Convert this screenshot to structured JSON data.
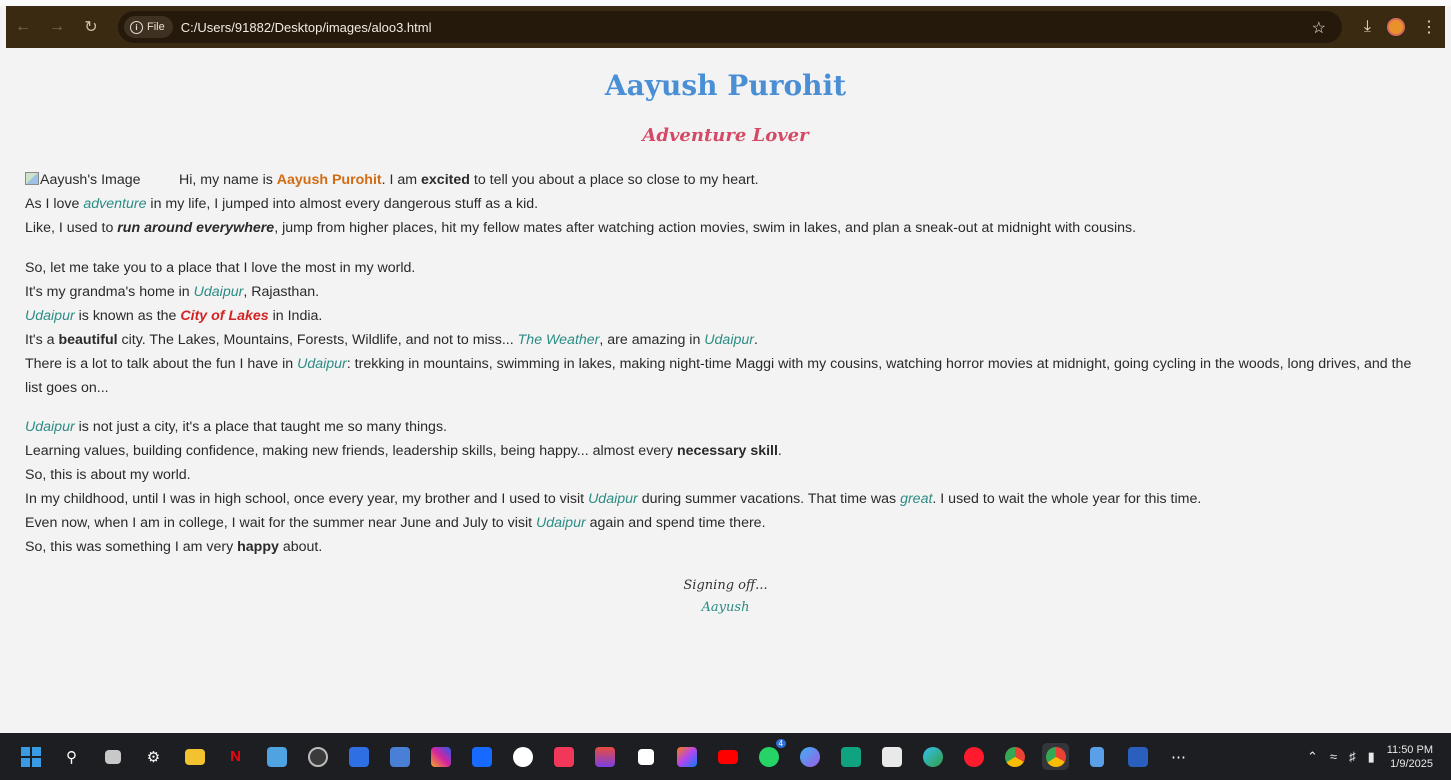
{
  "browser": {
    "site_chip": "File",
    "url": "C:/Users/91882/Desktop/images/aloo3.html"
  },
  "page": {
    "title": "Aayush Purohit",
    "subtitle": "Adventure Lover",
    "image_alt": "Aayush's Image",
    "p1": {
      "l1a": "Hi, my name is ",
      "name": "Aayush Purohit",
      "l1b": ". I am ",
      "excited": "excited",
      "l1c": " to tell you about a place so close to my heart.",
      "l2a": "As I love ",
      "adventure": "adventure",
      "l2b": " in my life, I jumped into almost every dangerous stuff as a kid.",
      "l3a": "Like, I used to ",
      "run": "run around everywhere",
      "l3b": ", jump from higher places, hit my fellow mates after watching action movies, swim in lakes, and plan a sneak-out at midnight with cousins."
    },
    "p2": {
      "l1": "So, let me take you to a place that I love the most in my world.",
      "l2a": "It's my grandma's home in ",
      "udaipur": "Udaipur",
      "l2b": ", Rajasthan.",
      "l3a": " is known as the ",
      "city_of_lakes": "City of Lakes",
      "l3b": " in India.",
      "l4a": "It's a ",
      "beautiful": "beautiful",
      "l4b": " city. The Lakes, Mountains, Forests, Wildlife, and not to miss... ",
      "weather": "The Weather",
      "l4c": ", are amazing in ",
      "l4d": ".",
      "l5a": "There is a lot to talk about the fun I have in ",
      "l5b": ": trekking in mountains, swimming in lakes, making night-time Maggi with my cousins, watching horror movies at midnight, going cycling in the woods, long drives, and the list goes on..."
    },
    "p3": {
      "udaipur": "Udaipur",
      "l1b": " is not just a city, it's a place that taught me so many things.",
      "l2a": "Learning values, building confidence, making new friends, leadership skills, being happy... almost every ",
      "necessary": "necessary skill",
      "l2b": ".",
      "l3": "So, this is about my world.",
      "l4a": "In my childhood, until I was in high school, once every year, my brother and I used to visit ",
      "l4b": " during summer vacations. That time was ",
      "great": "great",
      "l4c": ". I used to wait the whole year for this time.",
      "l5a": "Even now, when I am in college, I wait for the summer near June and July to visit ",
      "l5b": " again and spend time there.",
      "l6a": "So, this was something I am very ",
      "happy": "happy",
      "l6b": " about."
    },
    "signoff": {
      "line1": "Signing off...",
      "line2": "Aayush"
    }
  },
  "taskbar": {
    "whatsapp_badge": "4",
    "clock_time": "11:50 PM",
    "clock_date": "1/9/2025"
  },
  "colors": {
    "title": "#4a8fd6",
    "subtitle": "#d44a66",
    "highlight_name": "#d26b12",
    "teal": "#2b8c84",
    "city_of_lakes": "#d42323"
  }
}
